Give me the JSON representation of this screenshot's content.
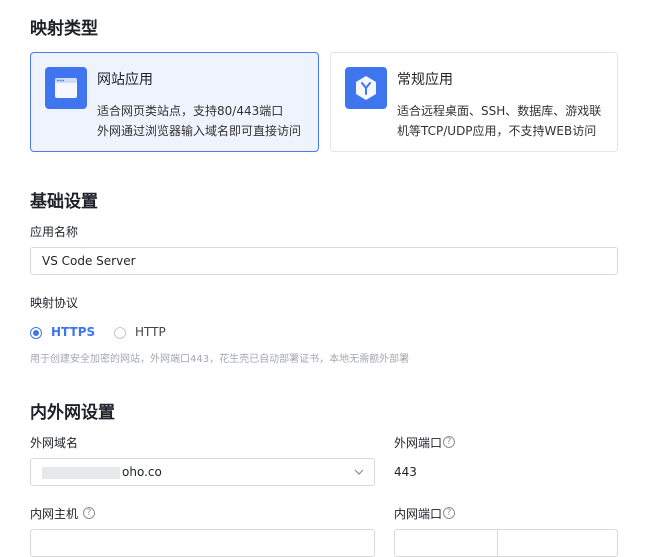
{
  "mapping_type": {
    "title": "映射类型",
    "options": [
      {
        "title": "网站应用",
        "desc_line1": "适合网页类站点，支持80/443端口",
        "desc_line2": "外网通过浏览器输入域名即可直接访问",
        "selected": true,
        "icon": "browser-window-icon"
      },
      {
        "title": "常规应用",
        "desc_line1": "适合远程桌面、SSH、数据库、游戏联",
        "desc_line2": "机等TCP/UDP应用，不支持WEB访问",
        "selected": false,
        "icon": "hexagon-y-icon"
      }
    ]
  },
  "basic": {
    "title": "基础设置",
    "app_name_label": "应用名称",
    "app_name_value": "VS Code Server",
    "protocol_label": "映射协议",
    "protocol_options": [
      {
        "label": "HTTPS",
        "selected": true
      },
      {
        "label": "HTTP",
        "selected": false
      }
    ],
    "protocol_hint": "用于创建安全加密的网站，外网端口443，花生壳已自动部署证书，本地无需额外部署"
  },
  "network": {
    "title": "内外网设置",
    "external_domain_label": "外网域名",
    "external_domain_suffix": "oho.co",
    "external_port_label": "外网端口",
    "external_port_value": "443",
    "internal_host_label": "内网主机",
    "internal_port_label": "内网端口",
    "help_glyph": "?"
  },
  "colors": {
    "accent": "#3f76f0",
    "selected_bg": "#eef3fe"
  }
}
